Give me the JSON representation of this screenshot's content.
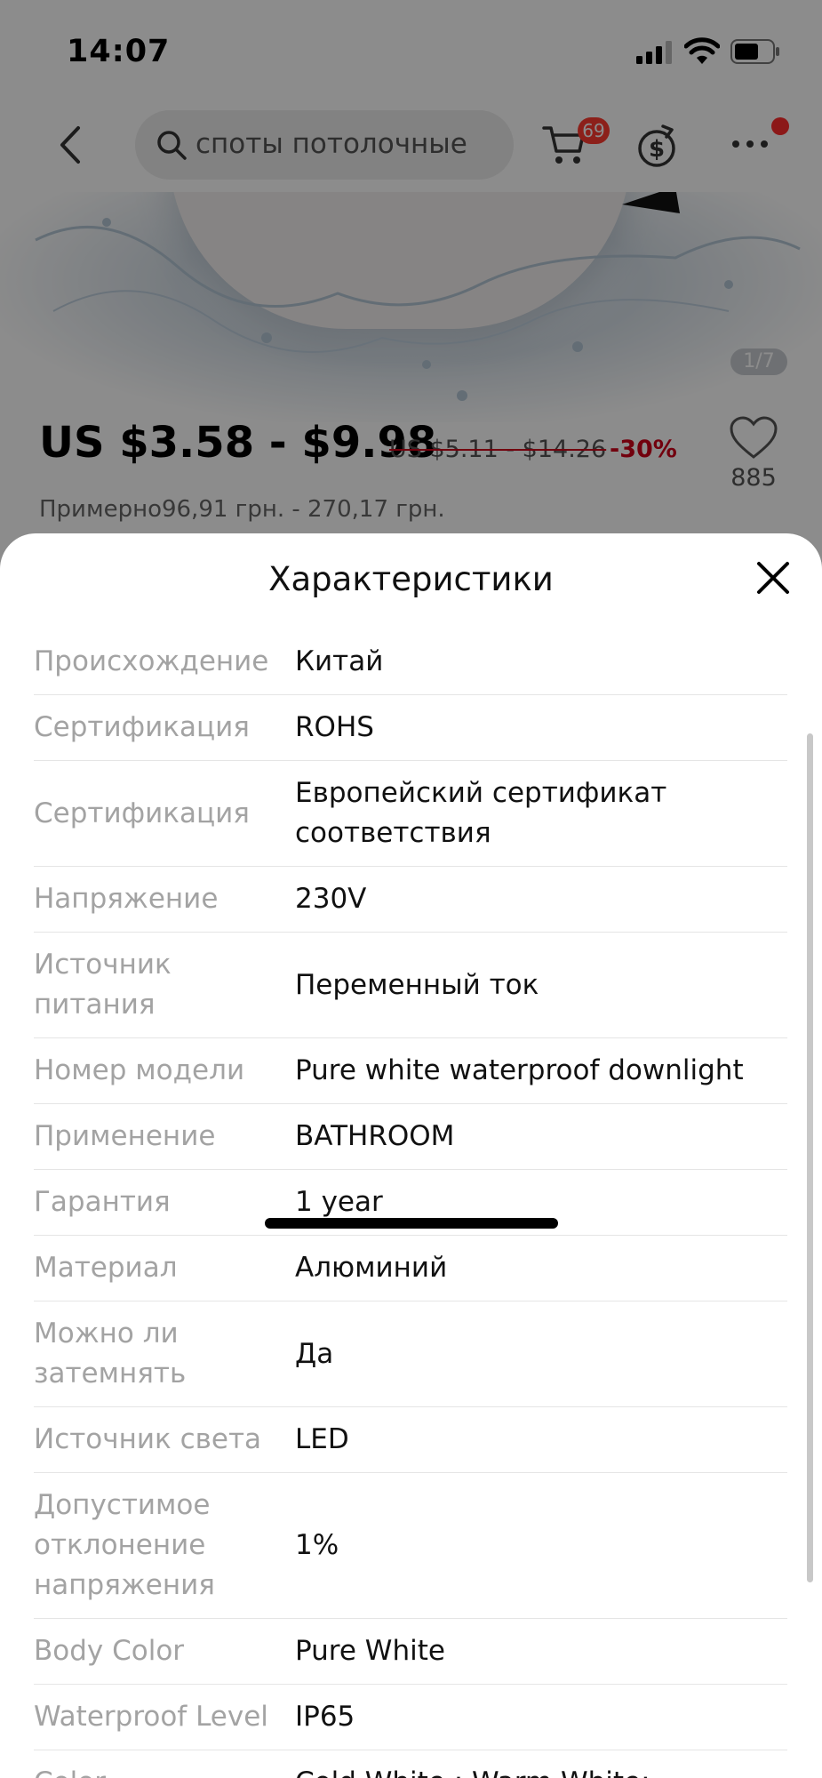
{
  "status": {
    "time": "14:07"
  },
  "header": {
    "search_text": "споты потолочные",
    "cart_count": "69"
  },
  "gallery": {
    "counter": "1/7"
  },
  "product": {
    "price": "US $3.58 - $9.98",
    "old_price": "US $5.11 - $14.26",
    "discount": "-30%",
    "likes": "885",
    "approx_price": "Примерно96,91 грн. - 270,17 грн."
  },
  "sheet": {
    "title": "Характеристики",
    "specs": [
      {
        "key": "Происхождение",
        "value": "Китай"
      },
      {
        "key": "Сертификация",
        "value": "ROHS"
      },
      {
        "key": "Сертификация",
        "value": "Европейский сертификат соответствия"
      },
      {
        "key": "Напряжение",
        "value": "230V"
      },
      {
        "key": "Источник питания",
        "value": "Переменный ток"
      },
      {
        "key": "Номер модели",
        "value": "Pure white waterproof downlight"
      },
      {
        "key": "Применение",
        "value": "BATHROOM"
      },
      {
        "key": "Гарантия",
        "value": "1 year"
      },
      {
        "key": "Материал",
        "value": "Алюминий"
      },
      {
        "key": "Можно ли затемнять",
        "value": "Да"
      },
      {
        "key": "Источник света",
        "value": "LED"
      },
      {
        "key": "Допустимое отклонение напряжения",
        "value": "1%"
      },
      {
        "key": "Body Color",
        "value": "Pure White"
      },
      {
        "key": "Waterproof Level",
        "value": "IP65"
      },
      {
        "key": "Color",
        "value": "Cold White ; Warm White;"
      }
    ]
  }
}
